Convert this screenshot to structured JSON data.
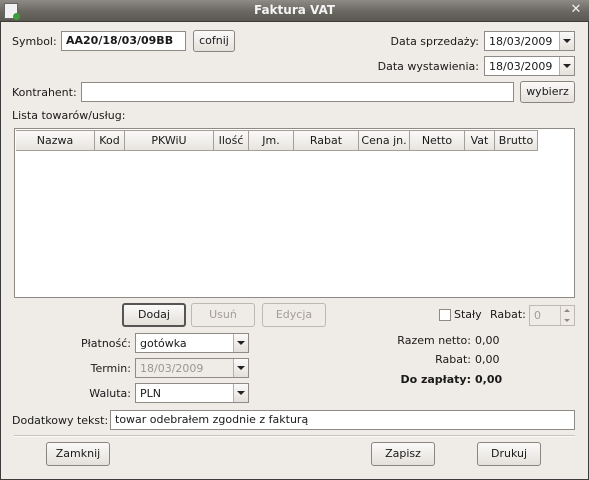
{
  "window": {
    "title": "Faktura VAT",
    "close_glyph": "✕"
  },
  "symbol": {
    "label": "Symbol:",
    "value": "AA20/18/03/09BB",
    "undo_button": "cofnij"
  },
  "sale_date": {
    "label": "Data sprzedaży:",
    "value": "18/03/2009"
  },
  "issue_date": {
    "label": "Data wystawienia:",
    "value": "18/03/2009"
  },
  "contractor": {
    "label": "Kontrahent:",
    "value": "",
    "select_button": "wybierz"
  },
  "items": {
    "label": "Lista towarów/usług:",
    "columns": [
      "Nazwa",
      "Kod",
      "PKWiU",
      "Ilość",
      "Jm.",
      "Rabat",
      "Cena jn.",
      "Netto",
      "Vat",
      "Brutto"
    ],
    "rows": []
  },
  "item_buttons": {
    "add": "Dodaj",
    "remove": "Usuń",
    "edit": "Edycja"
  },
  "constant": {
    "label": "Stały",
    "checked": false
  },
  "discount": {
    "label": "Rabat:",
    "value": "0"
  },
  "payment": {
    "label": "Płatność:",
    "value": "gotówka"
  },
  "due_date": {
    "label": "Termin:",
    "value": "18/03/2009"
  },
  "currency": {
    "label": "Waluta:",
    "value": "PLN"
  },
  "totals": {
    "net_label": "Razem netto:",
    "net_value": "0,00",
    "discount_label": "Rabat:",
    "discount_value": "0,00",
    "due_label": "Do zapłaty:",
    "due_value": "0,00"
  },
  "extra_text": {
    "label": "Dodatkowy tekst:",
    "value": "towar odebrałem zgodnie z fakturą"
  },
  "footer": {
    "close": "Zamknij",
    "save": "Zapisz",
    "print": "Drukuj"
  },
  "icons": {
    "app": "invoice-icon",
    "close": "close-icon",
    "dropdown": "chevron-down-icon"
  }
}
